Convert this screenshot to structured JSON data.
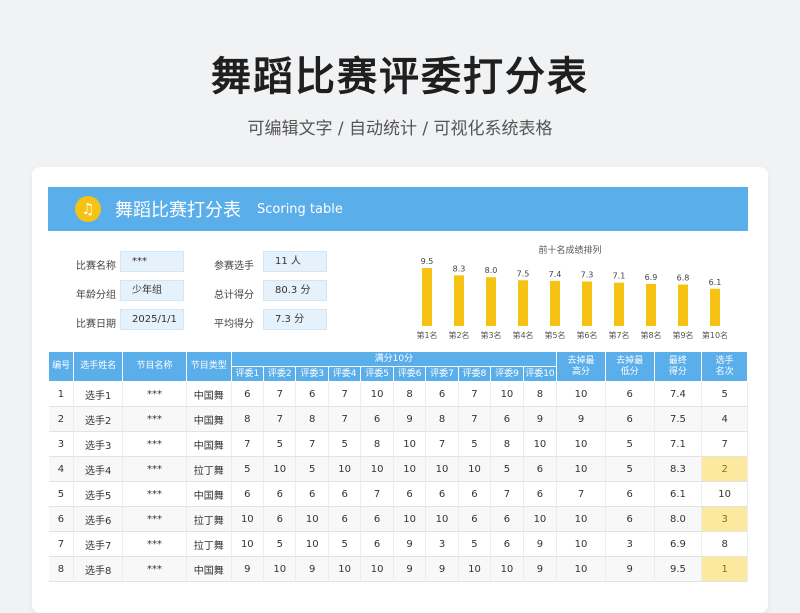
{
  "page": {
    "title": "舞蹈比赛评委打分表",
    "subtitle": "可编辑文字 / 自动统计 / 可视化系统表格"
  },
  "banner": {
    "icon": "music-note-icon",
    "title": "舞蹈比赛打分表",
    "subtitle": "Scoring table"
  },
  "info": {
    "name_label": "比赛名称",
    "name_value": "***",
    "group_label": "年龄分组",
    "group_value": "少年组",
    "date_label": "比赛日期",
    "date_value": "2025/1/1",
    "players_label": "参赛选手",
    "players_value": "11 人",
    "total_label": "总计得分",
    "total_value": "80.3 分",
    "avg_label": "平均得分",
    "avg_value": "7.3 分"
  },
  "chart_data": {
    "type": "bar",
    "title": "前十名成绩排列",
    "categories": [
      "第1名",
      "第2名",
      "第3名",
      "第4名",
      "第5名",
      "第6名",
      "第7名",
      "第8名",
      "第9名",
      "第10名"
    ],
    "values": [
      9.5,
      8.3,
      8.0,
      7.5,
      7.4,
      7.3,
      7.1,
      6.9,
      6.8,
      6.1
    ],
    "value_labels": [
      "9.5",
      "8.3",
      "8.0",
      "7.5",
      "7.4",
      "7.3",
      "7.1",
      "6.9",
      "6.8",
      "6.1"
    ],
    "ylim": [
      0,
      10
    ],
    "color": "#f6c315",
    "grid": false
  },
  "table": {
    "headers": {
      "num": "编号",
      "player": "选手姓名",
      "program": "节目名称",
      "type": "节目类型",
      "full_score": "满分10分",
      "judges": [
        "评委1",
        "评委2",
        "评委3",
        "评委4",
        "评委5",
        "评委6",
        "评委7",
        "评委8",
        "评委9",
        "评委10"
      ],
      "drop_high": "去掉最高分",
      "drop_low": "去掉最低分",
      "final": "最终得分",
      "rank": "选手名次"
    },
    "rows": [
      {
        "num": "1",
        "player": "选手1",
        "program": "***",
        "type": "中国舞",
        "scores": [
          "6",
          "7",
          "6",
          "7",
          "10",
          "8",
          "6",
          "7",
          "10",
          "8"
        ],
        "drop_high": "10",
        "drop_low": "6",
        "final": "7.4",
        "rank": "5",
        "top3": false
      },
      {
        "num": "2",
        "player": "选手2",
        "program": "***",
        "type": "中国舞",
        "scores": [
          "8",
          "7",
          "8",
          "7",
          "6",
          "9",
          "8",
          "7",
          "6",
          "9"
        ],
        "drop_high": "9",
        "drop_low": "6",
        "final": "7.5",
        "rank": "4",
        "top3": false
      },
      {
        "num": "3",
        "player": "选手3",
        "program": "***",
        "type": "中国舞",
        "scores": [
          "7",
          "5",
          "7",
          "5",
          "8",
          "10",
          "7",
          "5",
          "8",
          "10"
        ],
        "drop_high": "10",
        "drop_low": "5",
        "final": "7.1",
        "rank": "7",
        "top3": false
      },
      {
        "num": "4",
        "player": "选手4",
        "program": "***",
        "type": "拉丁舞",
        "scores": [
          "5",
          "10",
          "5",
          "10",
          "10",
          "10",
          "10",
          "10",
          "5",
          "6"
        ],
        "drop_high": "10",
        "drop_low": "5",
        "final": "8.3",
        "rank": "2",
        "top3": true
      },
      {
        "num": "5",
        "player": "选手5",
        "program": "***",
        "type": "中国舞",
        "scores": [
          "6",
          "6",
          "6",
          "6",
          "7",
          "6",
          "6",
          "6",
          "7",
          "6"
        ],
        "drop_high": "7",
        "drop_low": "6",
        "final": "6.1",
        "rank": "10",
        "top3": false
      },
      {
        "num": "6",
        "player": "选手6",
        "program": "***",
        "type": "拉丁舞",
        "scores": [
          "10",
          "6",
          "10",
          "6",
          "6",
          "10",
          "10",
          "6",
          "6",
          "10"
        ],
        "drop_high": "10",
        "drop_low": "6",
        "final": "8.0",
        "rank": "3",
        "top3": true
      },
      {
        "num": "7",
        "player": "选手7",
        "program": "***",
        "type": "拉丁舞",
        "scores": [
          "10",
          "5",
          "10",
          "5",
          "6",
          "9",
          "3",
          "5",
          "6",
          "9"
        ],
        "drop_high": "10",
        "drop_low": "3",
        "final": "6.9",
        "rank": "8",
        "top3": false
      },
      {
        "num": "8",
        "player": "选手8",
        "program": "***",
        "type": "中国舞",
        "scores": [
          "9",
          "10",
          "9",
          "10",
          "10",
          "9",
          "9",
          "10",
          "10",
          "9"
        ],
        "drop_high": "10",
        "drop_low": "9",
        "final": "9.5",
        "rank": "1",
        "top3": true
      }
    ]
  }
}
